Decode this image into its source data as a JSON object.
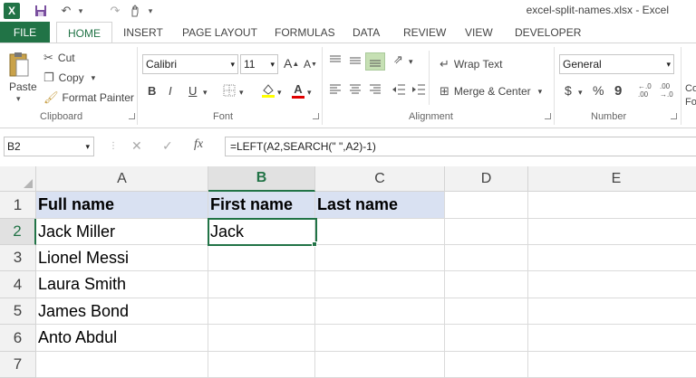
{
  "window": {
    "title": "excel-split-names.xlsx - Excel"
  },
  "quick_access": [
    {
      "name": "excel-logo-icon",
      "glyph": "X"
    },
    {
      "name": "save-icon",
      "glyph": "💾"
    },
    {
      "name": "undo-icon",
      "glyph": "↶"
    },
    {
      "name": "redo-icon",
      "glyph": "↷"
    },
    {
      "name": "touch-mode-icon",
      "glyph": "✋"
    }
  ],
  "tabs": {
    "file": "FILE",
    "home": "HOME",
    "insert": "INSERT",
    "page_layout": "PAGE LAYOUT",
    "formulas": "FORMULAS",
    "data": "DATA",
    "review": "REVIEW",
    "view": "VIEW",
    "developer": "DEVELOPER"
  },
  "clipboard": {
    "paste": "Paste",
    "cut": "Cut",
    "copy": "Copy",
    "format_painter": "Format Painter",
    "label": "Clipboard"
  },
  "font": {
    "name": "Calibri",
    "size": "11",
    "bold": "B",
    "italic": "I",
    "underline": "U",
    "label": "Font",
    "grow": "A",
    "shrink": "A",
    "color_letter": "A"
  },
  "alignment": {
    "wrap_text": "Wrap Text",
    "merge_center": "Merge & Center",
    "label": "Alignment"
  },
  "number": {
    "format": "General",
    "currency": "$",
    "percent": "%",
    "comma": "9",
    "label": "Number",
    "dec_inc": "←.0\n.00",
    "dec_dec": ".00\n→.0"
  },
  "styles_partial": {
    "cond_top": "Co",
    "cond_bottom": "Fo"
  },
  "formula_bar": {
    "name_box": "B2",
    "cancel": "✕",
    "enter": "✓",
    "fx": "fx",
    "formula": "=LEFT(A2,SEARCH(\" \",A2)-1)"
  },
  "grid": {
    "columns": [
      "A",
      "B",
      "C",
      "D",
      "E"
    ],
    "rows": [
      "1",
      "2",
      "3",
      "4",
      "5",
      "6",
      "7"
    ],
    "cells": [
      [
        "Full name",
        "First name",
        "Last name",
        "",
        ""
      ],
      [
        "Jack Miller",
        "Jack",
        "",
        "",
        ""
      ],
      [
        "Lionel Messi",
        "",
        "",
        "",
        ""
      ],
      [
        "Laura Smith",
        "",
        "",
        "",
        ""
      ],
      [
        "James Bond",
        "",
        "",
        "",
        ""
      ],
      [
        "Anto Abdul",
        "",
        "",
        "",
        ""
      ],
      [
        "",
        "",
        "",
        "",
        ""
      ]
    ],
    "selected": "B2"
  },
  "colors": {
    "accent": "#217346",
    "header_fill": "#d9e1f2"
  }
}
